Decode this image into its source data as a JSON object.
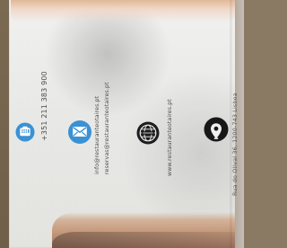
{
  "card": {
    "phone": "+351 211 383 900",
    "email_primary": "info@restauranteotaires.pt",
    "email_secondary": "reservas@restauranteotaires.pt",
    "website": "www.restauranteotaires.pt",
    "address": "Rua do Olival 36, 1200-743 Lisboa"
  },
  "icons": {
    "phone": "phone-icon",
    "email": "envelope-icon",
    "website": "globe-icon",
    "address": "map-pin-icon"
  },
  "colors": {
    "phone_icon": "#3a91d3",
    "email_icon": "#3a91d3",
    "web_icon": "#1d1d1d",
    "map_icon": "#181818",
    "text": "#4d4d4d"
  }
}
